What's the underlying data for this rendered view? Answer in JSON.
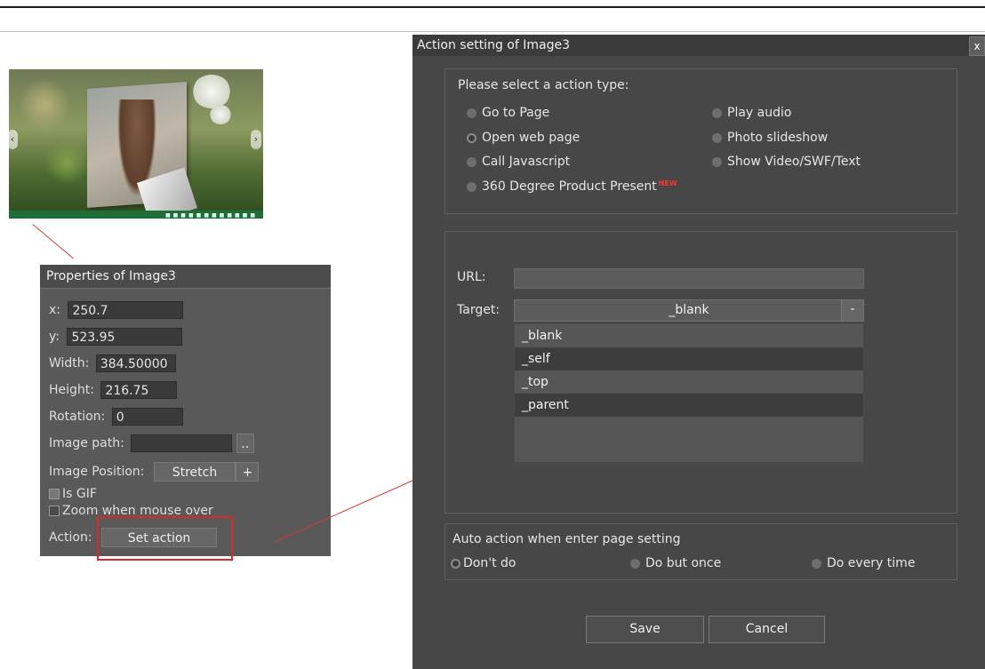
{
  "thumbnail": {
    "nav_prev_glyph": "‹",
    "nav_next_glyph": "›"
  },
  "properties": {
    "title": "Properties of Image3",
    "x_label": "x:",
    "x_value": "250.7",
    "y_label": "y:",
    "y_value": "523.95",
    "width_label": "Width:",
    "width_value": "384.50000",
    "height_label": "Height:",
    "height_value": "216.75",
    "rotation_label": "Rotation:",
    "rotation_value": "0",
    "image_path_label": "Image path:",
    "image_path_value": "",
    "browse_label": "..",
    "image_position_label": "Image Position:",
    "image_position_value": "Stretch",
    "image_position_plus": "+",
    "is_gif_label": "Is GIF",
    "zoom_label": "Zoom when mouse over",
    "action_label": "Action:",
    "set_action_label": "Set action"
  },
  "dialog": {
    "title": "Action setting of Image3",
    "close_label": "x",
    "action_type_heading": "Please select a action type:",
    "action_types": [
      {
        "label": "Go to Page",
        "selected": false
      },
      {
        "label": "Open web page",
        "selected": true
      },
      {
        "label": "Call Javascript",
        "selected": false
      },
      {
        "label": "360 Degree Product Present",
        "selected": false,
        "badge": "NEW"
      },
      {
        "label": "Play audio",
        "selected": false
      },
      {
        "label": "Photo slideshow",
        "selected": false
      },
      {
        "label": "Show Video/SWF/Text",
        "selected": false
      }
    ],
    "url_label": "URL:",
    "url_value": "",
    "target_label": "Target:",
    "target_selected": "_blank",
    "target_arrow": "-",
    "target_options": [
      "_blank",
      "_self",
      "_top",
      "_parent"
    ],
    "auto_action_heading": "Auto action when enter page setting",
    "auto_actions": [
      {
        "label": "Don't do",
        "selected": true
      },
      {
        "label": "Do but once",
        "selected": false
      },
      {
        "label": "Do every time",
        "selected": false
      }
    ],
    "save_label": "Save",
    "cancel_label": "Cancel"
  },
  "colors": {
    "highlight_red": "#d42a2a",
    "panel_bg": "#595959",
    "dialog_bg": "#474747"
  }
}
